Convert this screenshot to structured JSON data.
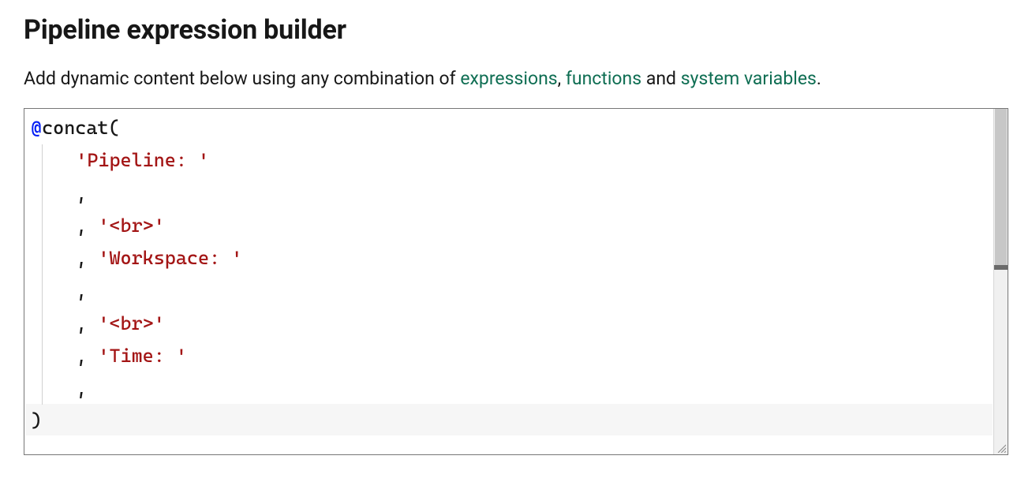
{
  "header": {
    "title": "Pipeline expression builder"
  },
  "intro": {
    "prefix": "Add dynamic content below using any combination of ",
    "link_expressions": "expressions",
    "comma1": ", ",
    "link_functions": "functions",
    "middle": " and ",
    "link_system_variables": "system variables",
    "suffix": "."
  },
  "editor": {
    "tokens": {
      "at": "@",
      "fn": "concat",
      "open": "(",
      "close": ")",
      "comma": ",",
      "str_pipeline": "'Pipeline: '",
      "str_br": "'<br>'",
      "str_workspace": "'Workspace: '",
      "str_time": "'Time: '"
    },
    "raw_expression": "@concat(\n    'Pipeline: '\n    ,\n    , '<br>'\n    , 'Workspace: '\n    ,\n    , '<br>'\n    , 'Time: '\n    ,\n)"
  }
}
